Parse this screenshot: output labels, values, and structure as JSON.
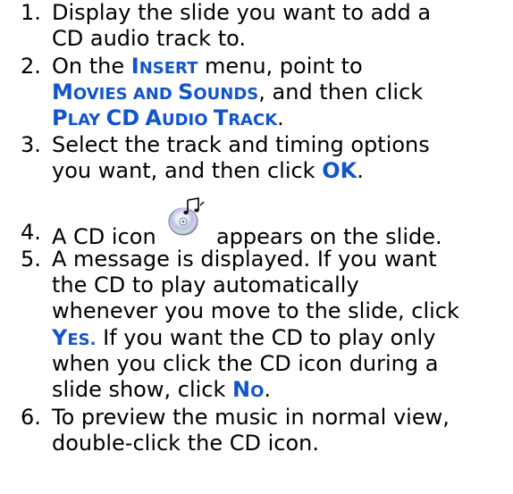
{
  "steps": [
    {
      "number": "1.",
      "line1": "Display the slide you want to add a",
      "line2": "CD audio track to."
    },
    {
      "number": "2.",
      "line1_prefix": "On the ",
      "insert_first": "I",
      "insert_rest": "NSERT",
      "line1_suffix": " menu, point to",
      "ms_first1": "M",
      "ms_rest1": "OVIES AND ",
      "ms_first2": "S",
      "ms_rest2": "OUNDS",
      "line2_suffix": ", and then click",
      "p_first1": "P",
      "p_rest1": "LAY ",
      "p_cd": "CD",
      "p_space": " ",
      "p_first2": "A",
      "p_rest2": "UDIO ",
      "p_first3": "T",
      "p_rest3": "RACK",
      "line3_suffix": "."
    },
    {
      "number": "3.",
      "line1": "Select the track and timing options",
      "line2_prefix": "you want, and then click ",
      "ok": "OK",
      "line2_suffix": "."
    },
    {
      "number": "4.",
      "line1_prefix": "A CD icon",
      "icon": "cd-music-icon",
      "line1_suffix": "appears on the slide."
    },
    {
      "number": "5.",
      "line1": "A message is displayed. If you want",
      "line2": "the CD to play automatically",
      "line3": "whenever you move to the slide, click",
      "yes_first": "Y",
      "yes_rest": "ES.",
      "line4_suffix": " If you want the CD to play only",
      "line5": "when you click the CD icon during a",
      "line6_prefix": "slide show, click ",
      "no_first": "N",
      "no_rest": "O",
      "line6_suffix": "."
    },
    {
      "number": "6.",
      "line1": "To preview the music in normal view,",
      "line2": "double-click the CD icon."
    }
  ],
  "colors": {
    "keyword": "#1155cc",
    "text": "#000000"
  }
}
